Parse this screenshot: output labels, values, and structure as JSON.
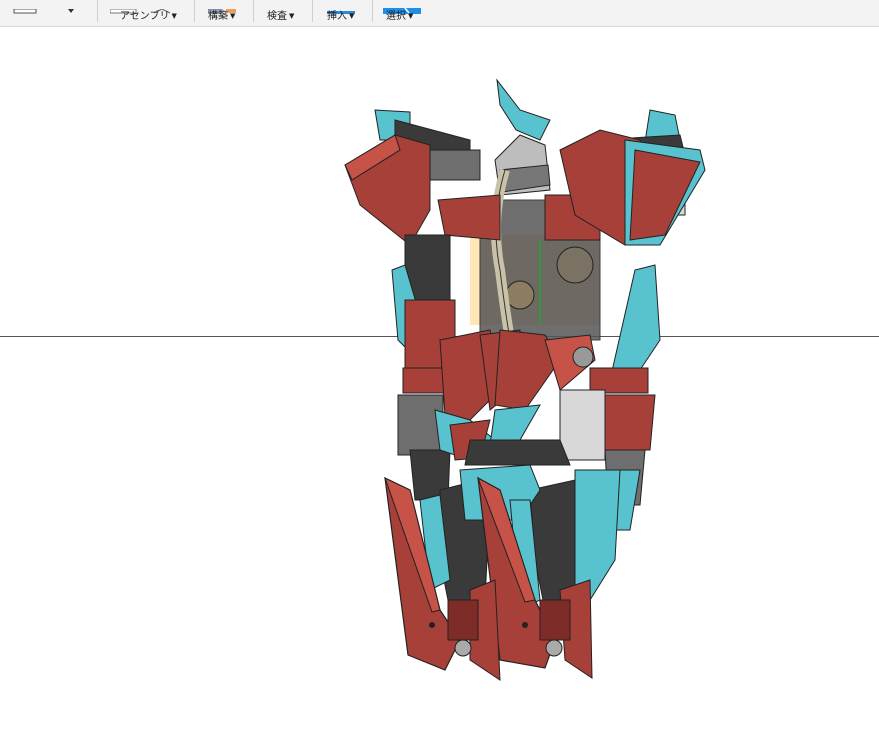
{
  "toolbar": {
    "groups": [
      {
        "label": "アセンブリ",
        "icon": "assembly-icon"
      },
      {
        "label": "構築",
        "icon": "construct-icon"
      },
      {
        "label": "検査",
        "icon": "inspect-icon"
      },
      {
        "label": "挿入",
        "icon": "insert-icon"
      },
      {
        "label": "選択",
        "icon": "select-icon"
      }
    ]
  },
  "viewport": {
    "model": "robot-mecha-model",
    "colors": {
      "red": "#a8403a",
      "red_dark": "#7e2c28",
      "cyan": "#58c3cf",
      "cyan_dark": "#2f97a3",
      "gray": "#6e6e6e",
      "dark": "#3a3a3a",
      "light": "#d8d8d8",
      "highlight": "#ffd27a",
      "axis": "#555555"
    }
  }
}
